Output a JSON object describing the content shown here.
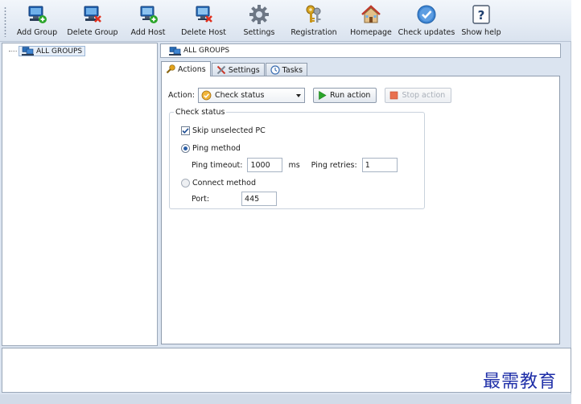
{
  "toolbar": {
    "buttons": [
      {
        "label": "Add Group",
        "icon": "add-group-icon"
      },
      {
        "label": "Delete Group",
        "icon": "delete-group-icon"
      },
      {
        "label": "Add Host",
        "icon": "add-host-icon"
      },
      {
        "label": "Delete Host",
        "icon": "delete-host-icon"
      },
      {
        "label": "Settings",
        "icon": "gear-icon"
      },
      {
        "label": "Registration",
        "icon": "keys-icon"
      },
      {
        "label": "Homepage",
        "icon": "home-icon"
      },
      {
        "label": "Check updates",
        "icon": "checkmark-icon"
      },
      {
        "label": "Show help",
        "icon": "question-icon"
      }
    ]
  },
  "tree": {
    "root_label": "ALL GROUPS"
  },
  "path": {
    "label": "ALL GROUPS"
  },
  "tabs": [
    {
      "label": "Actions",
      "active": true
    },
    {
      "label": "Settings",
      "active": false
    },
    {
      "label": "Tasks",
      "active": false
    }
  ],
  "action": {
    "label": "Action:",
    "selected": "Check status",
    "run_label": "Run action",
    "stop_label": "Stop action"
  },
  "check_status": {
    "title": "Check status",
    "skip_unselected_label": "Skip unselected PC",
    "skip_unselected_checked": true,
    "ping_method_label": "Ping method",
    "ping_method_selected": true,
    "ping_timeout_label": "Ping timeout:",
    "ping_timeout_value": "1000",
    "ping_timeout_unit": "ms",
    "ping_retries_label": "Ping retries:",
    "ping_retries_value": "1",
    "connect_method_label": "Connect method",
    "connect_method_selected": false,
    "port_label": "Port:",
    "port_value": "445"
  },
  "watermark": "最需教育",
  "colors": {
    "accent_blue": "#2b5fa8",
    "run_green": "#2aa52a",
    "stop_red": "#e04a2a",
    "watermark": "#1f2fa8"
  }
}
